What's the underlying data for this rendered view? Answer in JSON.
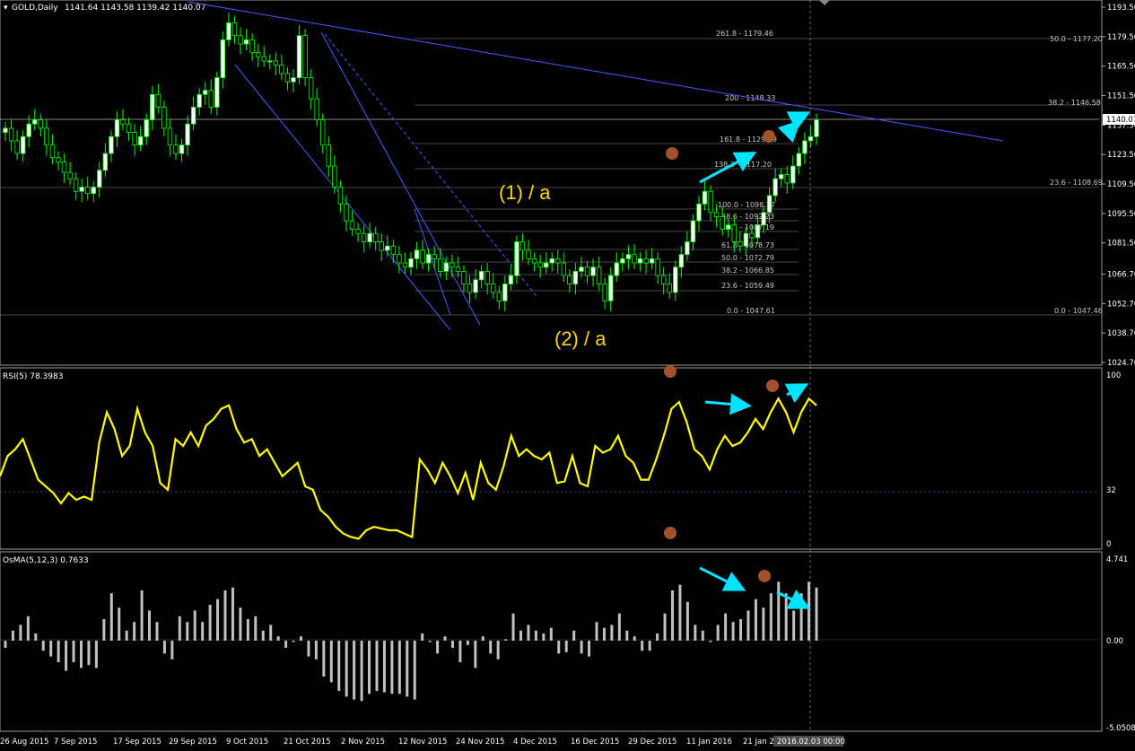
{
  "header": {
    "symbol_label": "GOLD,Daily",
    "ohlc": "1141.64 1143.58 1139.42 1140.07",
    "rsi_label": "RSI(5) 78.3983",
    "osma_label": "OsMA(5,12,3) 0.7633"
  },
  "annotations": {
    "wave_1": "(1) / a",
    "wave_2": "(2) / a",
    "cursor_time": "2016.02.03 00:00",
    "current_price": "1140.07"
  },
  "colors": {
    "background": "#000000",
    "bull_candle": "#ffffff",
    "bear_candle": "#000000",
    "candle_wick": "#00ff00",
    "trendline": "#4a5cff",
    "rsi_line": "#ffff00",
    "osma_bar": "#c0c0c0",
    "arrow": "#00e5ff",
    "marker": "#a0522d",
    "label": "#ffd700"
  },
  "chart_data": [
    {
      "type": "candlestick",
      "name": "price",
      "ylim": [
        1024.7,
        1193.5
      ],
      "yticks": [
        "1193.50",
        "1179.50",
        "1165.50",
        "1151.50",
        "1137.50",
        "1123.50",
        "1109.50",
        "1095.50",
        "1081.50",
        "1066.70",
        "1052.70",
        "1038.70",
        "1024.70"
      ],
      "close": [
        1136,
        1130,
        1124,
        1132,
        1138,
        1140,
        1136,
        1128,
        1122,
        1120,
        1115,
        1112,
        1106,
        1108,
        1105,
        1108,
        1116,
        1124,
        1132,
        1140,
        1138,
        1134,
        1128,
        1132,
        1140,
        1152,
        1146,
        1136,
        1128,
        1124,
        1128,
        1138,
        1146,
        1152,
        1154,
        1146,
        1160,
        1178,
        1186,
        1180,
        1176,
        1178,
        1172,
        1170,
        1168,
        1168,
        1166,
        1162,
        1158,
        1160,
        1180,
        1160,
        1150,
        1140,
        1128,
        1118,
        1108,
        1100,
        1092,
        1088,
        1086,
        1082,
        1086,
        1082,
        1078,
        1080,
        1076,
        1072,
        1070,
        1074,
        1078,
        1072,
        1076,
        1074,
        1068,
        1072,
        1070,
        1068,
        1062,
        1058,
        1064,
        1068,
        1062,
        1058,
        1054,
        1062,
        1066,
        1082,
        1078,
        1074,
        1072,
        1070,
        1072,
        1074,
        1072,
        1066,
        1062,
        1068,
        1070,
        1066,
        1070,
        1062,
        1054,
        1066,
        1072,
        1074,
        1076,
        1072,
        1074,
        1072,
        1074,
        1066,
        1062,
        1058,
        1070,
        1076,
        1082,
        1092,
        1100,
        1106,
        1096,
        1094,
        1088,
        1090,
        1082,
        1080,
        1086,
        1084,
        1090,
        1096,
        1104,
        1112,
        1114,
        1110,
        1118,
        1124,
        1130,
        1132,
        1140
      ],
      "rsi": {
        "name": "RSI(5)",
        "ylim": [
          0,
          100
        ],
        "levels": [
          32
        ],
        "yticks": [
          "100",
          "32",
          "0"
        ],
        "values": [
          40,
          52,
          56,
          62,
          50,
          38,
          34,
          30,
          24,
          30,
          26,
          28,
          26,
          60,
          78,
          68,
          52,
          58,
          80,
          66,
          58,
          36,
          32,
          62,
          58,
          66,
          58,
          70,
          74,
          80,
          82,
          68,
          60,
          62,
          52,
          56,
          48,
          40,
          44,
          48,
          34,
          32,
          20,
          16,
          10,
          6,
          4,
          3,
          8,
          10,
          9,
          8,
          8,
          6,
          4,
          50,
          44,
          36,
          48,
          40,
          30,
          42,
          26,
          48,
          36,
          32,
          46,
          64,
          52,
          56,
          52,
          50,
          54,
          36,
          37,
          52,
          36,
          34,
          58,
          54,
          56,
          64,
          52,
          48,
          38,
          38,
          50,
          64,
          80,
          84,
          72,
          56,
          52,
          44,
          56,
          64,
          58,
          60,
          66,
          74,
          68,
          78,
          86,
          78,
          66,
          78,
          86,
          82
        ]
      },
      "osma": {
        "name": "OsMA(5,12,3)",
        "ylim": [
          -5.0508,
          4.741
        ],
        "yticks": [
          "4.741",
          "0.00",
          "-5.0508"
        ]
      }
    }
  ],
  "xaxis": {
    "labels": [
      "26 Aug 2015",
      "7 Sep 2015",
      "17 Sep 2015",
      "29 Sep 2015",
      "9 Oct 2015",
      "21 Oct 2015",
      "2 Nov 2015",
      "12 Nov 2015",
      "24 Nov 2015",
      "4 Dec 2015",
      "16 Dec 2015",
      "29 Dec 2015",
      "11 Jan 2016",
      "21 Jan 2"
    ]
  },
  "fibonacci": {
    "upper": [
      "261.8 - 1179.46",
      "200 - 1148.33",
      "161.8 - 1129.09",
      "138.2 - 1117.20",
      "100.0 - 1098.37",
      "88.6 - 1092.23",
      "76.4 - 1087.19",
      "61.8 - 1078.73",
      "50.0 - 1072.79",
      "38.2 - 1066.85",
      "23.6 - 1059.49",
      "0.0 - 1047.61"
    ],
    "right": [
      "50.0 - 1177.20",
      "38.2 - 1146.58",
      "23.6 - 1108.69",
      "0.0 - 1047.46"
    ]
  }
}
